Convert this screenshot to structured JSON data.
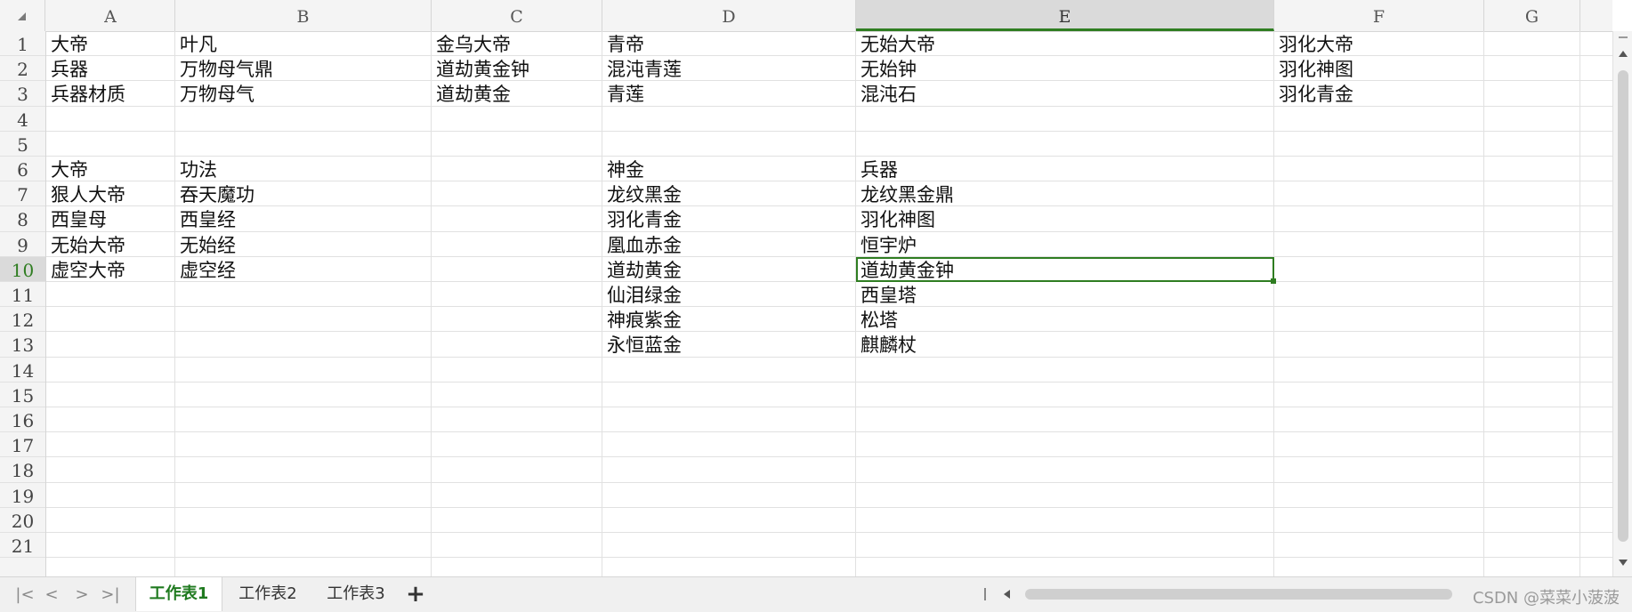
{
  "columns": [
    "A",
    "B",
    "C",
    "D",
    "E",
    "F",
    "G"
  ],
  "active_column": "E",
  "rows": [
    "1",
    "2",
    "3",
    "4",
    "5",
    "6",
    "7",
    "8",
    "9",
    "10",
    "11",
    "12",
    "13",
    "14",
    "15",
    "16",
    "17",
    "18",
    "19",
    "20",
    "21"
  ],
  "active_row": "10",
  "cells": {
    "A1": "大帝",
    "B1": "叶凡",
    "C1": "金乌大帝",
    "D1": "青帝",
    "E1": "无始大帝",
    "F1": "羽化大帝",
    "A2": "兵器",
    "B2": "万物母气鼎",
    "C2": "道劫黄金钟",
    "D2": "混沌青莲",
    "E2": "无始钟",
    "F2": "羽化神图",
    "A3": "兵器材质",
    "B3": "万物母气",
    "C3": "道劫黄金",
    "D3": "青莲",
    "E3": "混沌石",
    "F3": "羽化青金",
    "A6": "大帝",
    "B6": "功法",
    "D6": "神金",
    "E6": "兵器",
    "A7": "狠人大帝",
    "B7": "吞天魔功",
    "D7": "龙纹黑金",
    "E7": "龙纹黑金鼎",
    "A8": "西皇母",
    "B8": "西皇经",
    "D8": "羽化青金",
    "E8": "羽化神图",
    "A9": "无始大帝",
    "B9": "无始经",
    "D9": "凰血赤金",
    "E9": "恒宇炉",
    "A10": "虚空大帝",
    "B10": "虚空经",
    "D10": "道劫黄金",
    "E10": "道劫黄金钟",
    "D11": "仙泪绿金",
    "E11": "西皇塔",
    "D12": "神痕紫金",
    "E12": "松塔",
    "D13": "永恒蓝金",
    "E13": "麒麟杖"
  },
  "selected_cell": "E10",
  "sheet_tabs": [
    {
      "label": "工作表1",
      "active": true
    },
    {
      "label": "工作表2",
      "active": false
    },
    {
      "label": "工作表3",
      "active": false
    }
  ],
  "add_sheet_label": "+",
  "nav_buttons": [
    "|<",
    "<",
    ">",
    ">|"
  ],
  "watermark": "CSDN @菜菜小菠菠",
  "colors": {
    "accent": "#2f7d21",
    "header_bg": "#f4f4f4",
    "gridline": "#e1e1e1"
  }
}
